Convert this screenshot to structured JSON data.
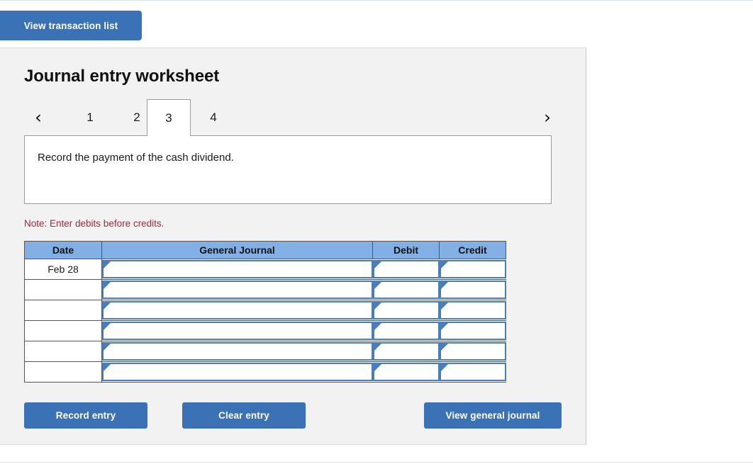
{
  "top": {
    "view_transaction_list_label": "View transaction list"
  },
  "panel": {
    "title": "Journal entry worksheet",
    "tabs": {
      "prev_icon": "chevron-left-icon",
      "next_icon": "chevron-right-icon",
      "prev_glyph": "‹",
      "next_glyph": "›",
      "items": [
        {
          "label": "1",
          "active": false
        },
        {
          "label": "2",
          "active": false
        },
        {
          "label": "3",
          "active": true
        },
        {
          "label": "4",
          "active": false
        }
      ]
    },
    "description": "Record the payment of the cash dividend.",
    "note": "Note: Enter debits before credits.",
    "table": {
      "headers": [
        "Date",
        "General Journal",
        "Debit",
        "Credit"
      ],
      "rows": [
        {
          "date": "Feb 28",
          "general_journal": "",
          "debit": "",
          "credit": ""
        },
        {
          "date": "",
          "general_journal": "",
          "debit": "",
          "credit": ""
        },
        {
          "date": "",
          "general_journal": "",
          "debit": "",
          "credit": ""
        },
        {
          "date": "",
          "general_journal": "",
          "debit": "",
          "credit": ""
        },
        {
          "date": "",
          "general_journal": "",
          "debit": "",
          "credit": ""
        },
        {
          "date": "",
          "general_journal": "",
          "debit": "",
          "credit": ""
        }
      ]
    },
    "buttons": {
      "record_entry": "Record entry",
      "clear_entry": "Clear entry",
      "view_general_journal": "View general journal"
    }
  },
  "colors": {
    "button_blue": "#3a72b5",
    "table_header_blue": "#82b0e4",
    "cell_border_blue": "#4a7ebb",
    "note_red": "#a5283c",
    "panel_gray": "#f2f2f2"
  }
}
